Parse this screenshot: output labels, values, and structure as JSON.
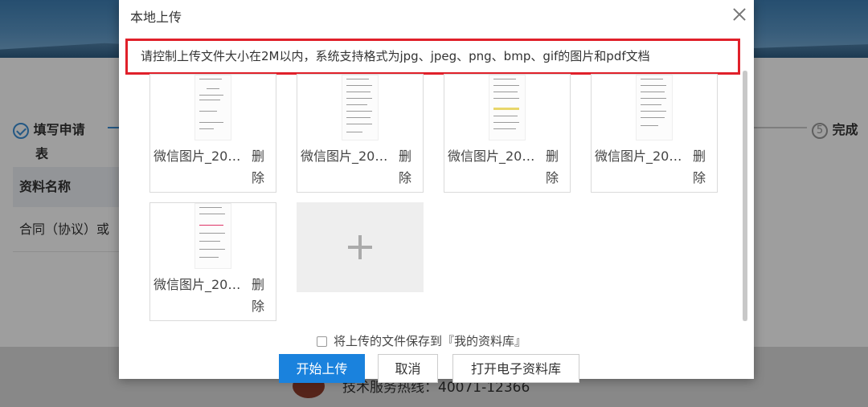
{
  "background": {
    "step1_label_line1": "填写申请",
    "step1_label_line2": "表",
    "step5_number": "5",
    "step5_label": "完成",
    "table_header": "资料名称",
    "table_cell": "合同（协议）或",
    "footer_text": "技术服务热线：40071-12366"
  },
  "modal": {
    "title": "本地上传",
    "close_icon": "close-icon",
    "notice": "请控制上传文件大小在2M以内，系统支持格式为jpg、jpeg、png、bmp、gif的图片和pdf文档",
    "files": [
      {
        "name": "微信图片_20…",
        "delete_label": "删除"
      },
      {
        "name": "微信图片_20…",
        "delete_label": "删除"
      },
      {
        "name": "微信图片_20…",
        "delete_label": "删除"
      },
      {
        "name": "微信图片_20…",
        "delete_label": "删除"
      },
      {
        "name": "微信图片_20…",
        "delete_label": "删除"
      }
    ],
    "add_icon": "plus-icon",
    "save_checkbox_label": "将上传的文件保存到『我的资料库』",
    "save_checked": false,
    "buttons": {
      "start_upload": "开始上传",
      "cancel": "取消",
      "open_library": "打开电子资料库"
    }
  },
  "colors": {
    "primary": "#1a82dd",
    "notice_border": "#e0202a",
    "step_active": "#3a8fd6"
  }
}
